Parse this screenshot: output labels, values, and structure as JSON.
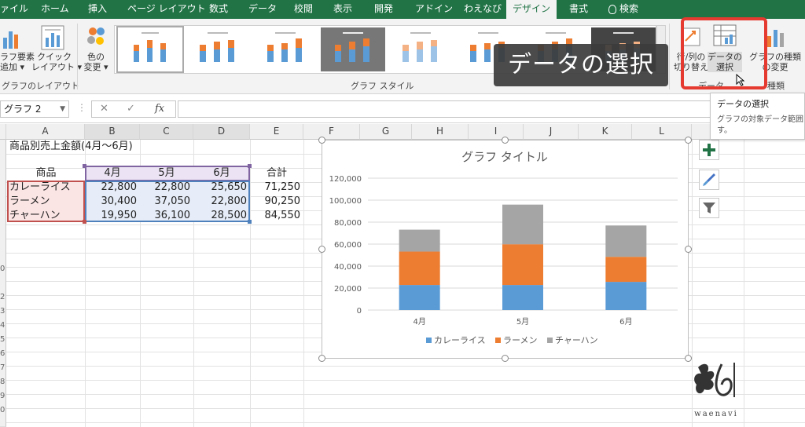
{
  "tabs": [
    {
      "label": "ァイル"
    },
    {
      "label": "ホーム"
    },
    {
      "label": "挿入"
    },
    {
      "label": "ページ レイアウト"
    },
    {
      "label": "数式"
    },
    {
      "label": "データ"
    },
    {
      "label": "校閲"
    },
    {
      "label": "表示"
    },
    {
      "label": "開発"
    },
    {
      "label": "アドイン"
    },
    {
      "label": "わえなび"
    },
    {
      "label": "デザイン",
      "active": true
    },
    {
      "label": "書式"
    },
    {
      "label": "検索"
    }
  ],
  "ribbon": {
    "add_element": "ラフ要素\n追加 ▾",
    "quick_layout": "クイック\nレイアウト ▾",
    "group_layout": "グラフのレイアウト",
    "change_color": "色の\n変更 ▾",
    "group_style": "グラフ スタイル",
    "switch_row_col": "行/列の\n切り替え",
    "select_data": "データの\n選択",
    "change_type": "グラフの種類\nの変更",
    "group_data": "データ",
    "group_type": "種類"
  },
  "caption": "データの選択",
  "tooltip": {
    "title": "データの選択",
    "body": "グラフの対象データ範囲を\nす。"
  },
  "formula_bar": {
    "name_box": "グラフ 2",
    "cancel": "✕",
    "enter": "✓",
    "fx": "fx"
  },
  "columns": [
    "A",
    "B",
    "C",
    "D",
    "E",
    "F",
    "G",
    "H",
    "I",
    "J",
    "K",
    "L"
  ],
  "row_numbers": [
    "",
    "",
    "",
    "",
    "",
    "",
    "",
    "",
    "0",
    "",
    "2",
    "3",
    "4",
    "5",
    "6",
    "7",
    "8",
    "9",
    "0"
  ],
  "sheet": {
    "title": "商品別売上金額(4月～6月)",
    "headers": {
      "product": "商品",
      "apr": "4月",
      "may": "5月",
      "jun": "6月",
      "total": "合計"
    },
    "rows": [
      {
        "name": "カレーライス",
        "apr": "22,800",
        "may": "22,800",
        "jun": "25,650",
        "total": "71,250"
      },
      {
        "name": "ラーメン",
        "apr": "30,400",
        "may": "37,050",
        "jun": "22,800",
        "total": "90,250"
      },
      {
        "name": "チャーハン",
        "apr": "19,950",
        "may": "36,100",
        "jun": "28,500",
        "total": "84,550"
      }
    ]
  },
  "chart_data": {
    "type": "bar",
    "stacked": true,
    "title": "グラフ タイトル",
    "categories": [
      "4月",
      "5月",
      "6月"
    ],
    "series": [
      {
        "name": "カレーライス",
        "values": [
          22800,
          22800,
          25650
        ],
        "color": "#5b9bd5"
      },
      {
        "name": "ラーメン",
        "values": [
          30400,
          37050,
          22800
        ],
        "color": "#ed7d31"
      },
      {
        "name": "チャーハン",
        "values": [
          19950,
          36100,
          28500
        ],
        "color": "#a5a5a5"
      }
    ],
    "ylim": [
      0,
      120000
    ],
    "yticks": [
      "0",
      "20,000",
      "40,000",
      "60,000",
      "80,000",
      "100,000",
      "120,000"
    ],
    "grid": true,
    "legend": "bottom"
  },
  "watermark": "waenavi"
}
